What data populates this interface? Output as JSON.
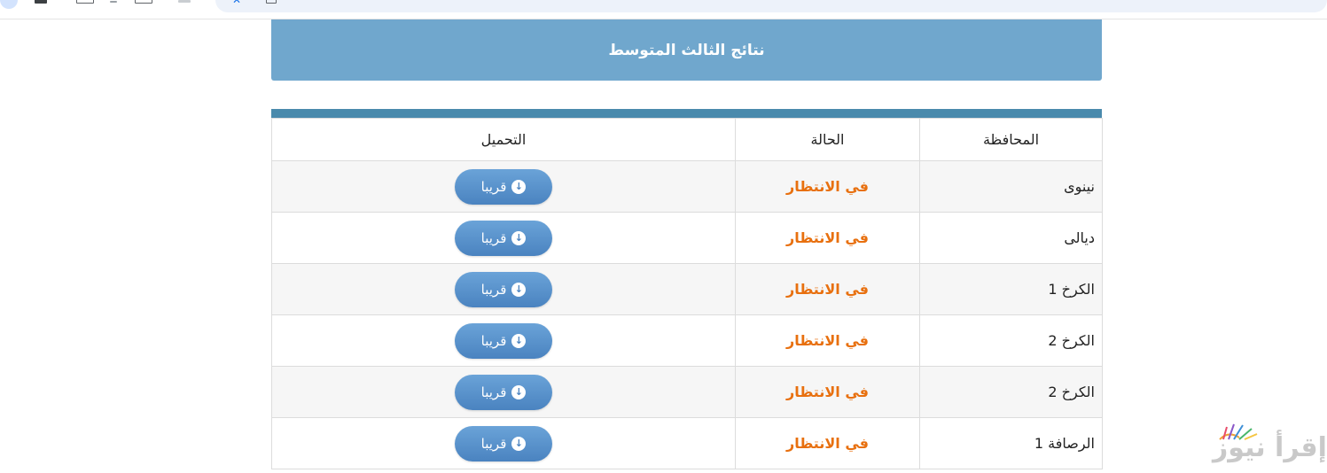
{
  "header": {
    "title": "نتائج الثالث المتوسط"
  },
  "table": {
    "columns": [
      "المحافظة",
      "الحالة",
      "التحميل"
    ],
    "rows": [
      {
        "governorate": "نينوى",
        "status": "في الانتظار",
        "download": "قريبا"
      },
      {
        "governorate": "ديالى",
        "status": "في الانتظار",
        "download": "قريبا"
      },
      {
        "governorate": "الكرخ 1",
        "status": "في الانتظار",
        "download": "قريبا"
      },
      {
        "governorate": "الكرخ 2",
        "status": "في الانتظار",
        "download": "قريبا"
      },
      {
        "governorate": "الكرخ 2",
        "status": "في الانتظار",
        "download": "قريبا"
      },
      {
        "governorate": "الرصافة 1",
        "status": "في الانتظار",
        "download": "قريبا"
      }
    ]
  },
  "watermark": {
    "text": "إقرأ نيوز"
  },
  "icons": {
    "download": "download-circle-icon"
  },
  "colors": {
    "header": "#70a7cd",
    "status": "#e8700f",
    "button": "#4a83c0",
    "table_top": "#4a8aac"
  }
}
